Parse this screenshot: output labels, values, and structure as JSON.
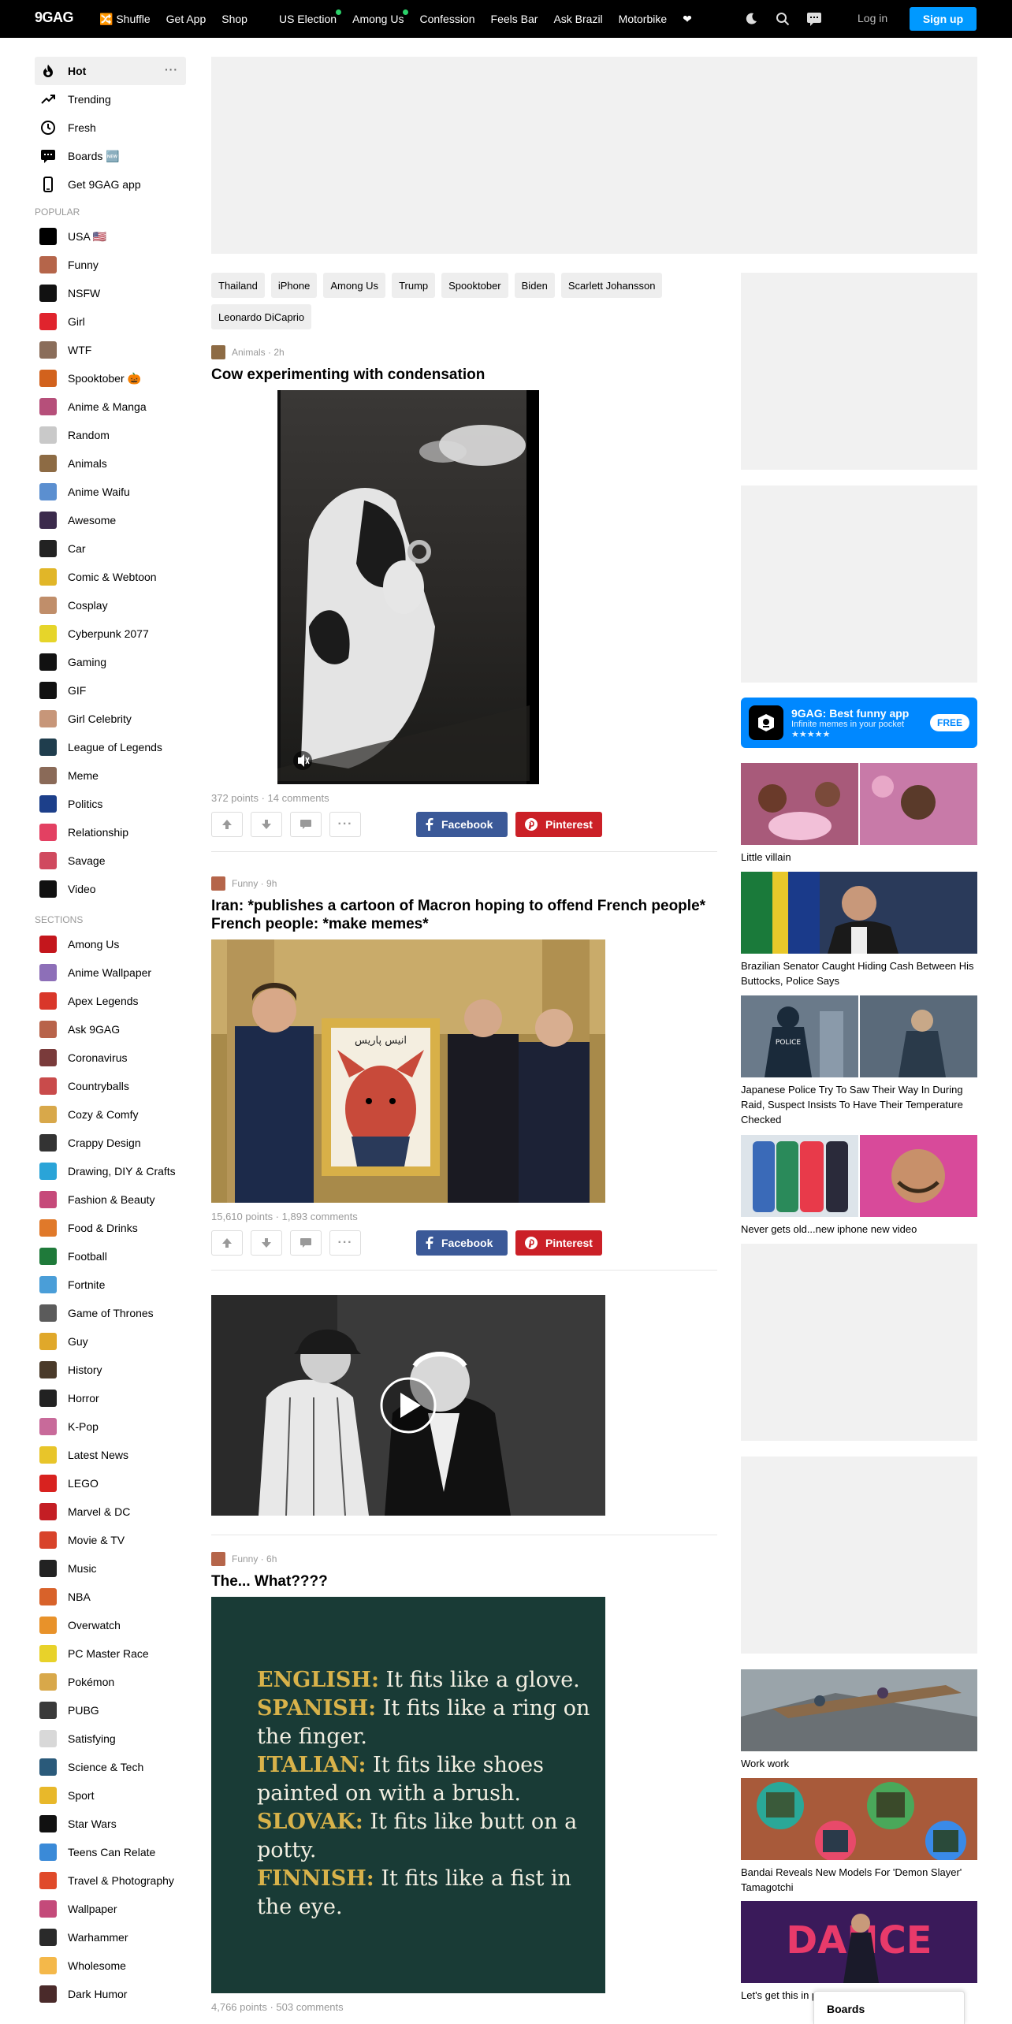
{
  "header": {
    "logo": "9GAG",
    "nav": [
      {
        "label": "🔀 Shuffle",
        "dot": false
      },
      {
        "label": " Get App",
        "dot": false
      },
      {
        "label": " Shop",
        "dot": false
      },
      {
        "label": "",
        "dot": false
      },
      {
        "label": "US Election",
        "dot": true
      },
      {
        "label": "Among Us",
        "dot": true
      },
      {
        "label": "Confession",
        "dot": false
      },
      {
        "label": "Feels Bar",
        "dot": false
      },
      {
        "label": "Ask Brazil",
        "dot": false
      },
      {
        "label": "Motorbike",
        "dot": false
      },
      {
        "label": "❤",
        "dot": false
      }
    ],
    "login": "Log in",
    "signup": "Sign up"
  },
  "sidebar": {
    "main": [
      {
        "label": "Hot",
        "icon": "flame-icon",
        "active": true
      },
      {
        "label": "Trending",
        "icon": "trending-icon"
      },
      {
        "label": "Fresh",
        "icon": "clock-icon"
      },
      {
        "label": "Boards 🆕",
        "icon": "chat-icon"
      },
      {
        "label": "Get 9GAG app",
        "icon": "phone-icon"
      }
    ],
    "popular_label": "POPULAR",
    "popular": [
      {
        "label": "USA 🇺🇸",
        "color": "#000000"
      },
      {
        "label": "Funny",
        "color": "#b5654a"
      },
      {
        "label": "NSFW",
        "color": "#111111"
      },
      {
        "label": "Girl",
        "color": "#e0242d"
      },
      {
        "label": "WTF",
        "color": "#8a6d5a"
      },
      {
        "label": "Spooktober 🎃",
        "color": "#d2621d"
      },
      {
        "label": "Anime & Manga",
        "color": "#b64f7a"
      },
      {
        "label": "Random",
        "color": "#c9c9c9"
      },
      {
        "label": "Animals",
        "color": "#8d6b44"
      },
      {
        "label": "Anime Waifu",
        "color": "#5b8fd0"
      },
      {
        "label": "Awesome",
        "color": "#3b2a4c"
      },
      {
        "label": "Car",
        "color": "#222222"
      },
      {
        "label": "Comic & Webtoon",
        "color": "#e1b628"
      },
      {
        "label": "Cosplay",
        "color": "#c08e6a"
      },
      {
        "label": "Cyberpunk 2077",
        "color": "#e6d52a"
      },
      {
        "label": "Gaming",
        "color": "#111111"
      },
      {
        "label": "GIF",
        "color": "#111111"
      },
      {
        "label": "Girl Celebrity",
        "color": "#c79679"
      },
      {
        "label": "League of Legends",
        "color": "#1f3d4d"
      },
      {
        "label": "Meme",
        "color": "#8a6a58"
      },
      {
        "label": "Politics",
        "color": "#1c3f8a"
      },
      {
        "label": "Relationship",
        "color": "#e34062"
      },
      {
        "label": "Savage",
        "color": "#d04a5f"
      },
      {
        "label": "Video",
        "color": "#111111"
      }
    ],
    "sections_label": "SECTIONS",
    "sections": [
      {
        "label": "Among Us",
        "color": "#c4161c"
      },
      {
        "label": "Anime Wallpaper",
        "color": "#8d6fb8"
      },
      {
        "label": "Apex Legends",
        "color": "#d9372a"
      },
      {
        "label": "Ask 9GAG",
        "color": "#b8634a"
      },
      {
        "label": "Coronavirus",
        "color": "#7a3b3b"
      },
      {
        "label": "Countryballs",
        "color": "#c94b4b"
      },
      {
        "label": "Cozy & Comfy",
        "color": "#d8a84a"
      },
      {
        "label": "Crappy Design",
        "color": "#333333"
      },
      {
        "label": "Drawing, DIY & Crafts",
        "color": "#2aa4d8"
      },
      {
        "label": "Fashion & Beauty",
        "color": "#c64a7a"
      },
      {
        "label": "Food & Drinks",
        "color": "#e0792a"
      },
      {
        "label": "Football",
        "color": "#1f7a3a"
      },
      {
        "label": "Fortnite",
        "color": "#4a9ed8"
      },
      {
        "label": "Game of Thrones",
        "color": "#5b5b5b"
      },
      {
        "label": "Guy",
        "color": "#e0a82a"
      },
      {
        "label": "History",
        "color": "#4a3a2a"
      },
      {
        "label": "Horror",
        "color": "#222222"
      },
      {
        "label": "K-Pop",
        "color": "#c86a9a"
      },
      {
        "label": "Latest News",
        "color": "#e8c52a"
      },
      {
        "label": "LEGO",
        "color": "#d8221f"
      },
      {
        "label": "Marvel & DC",
        "color": "#c41e24"
      },
      {
        "label": "Movie & TV",
        "color": "#d8432a"
      },
      {
        "label": "Music",
        "color": "#222222"
      },
      {
        "label": "NBA",
        "color": "#d8622a"
      },
      {
        "label": "Overwatch",
        "color": "#e8922a"
      },
      {
        "label": "PC Master Race",
        "color": "#e8d22a"
      },
      {
        "label": "Pokémon",
        "color": "#d8a84a"
      },
      {
        "label": "PUBG",
        "color": "#3a3a3a"
      },
      {
        "label": "Satisfying",
        "color": "#d8d8d8"
      },
      {
        "label": "Science & Tech",
        "color": "#2a5a7a"
      },
      {
        "label": "Sport",
        "color": "#e8b82a"
      },
      {
        "label": "Star Wars",
        "color": "#111111"
      },
      {
        "label": "Teens Can Relate",
        "color": "#3a8ad8"
      },
      {
        "label": "Travel & Photography",
        "color": "#e04a2a"
      },
      {
        "label": "Wallpaper",
        "color": "#c44a7a"
      },
      {
        "label": "Warhammer",
        "color": "#2a2a2a"
      },
      {
        "label": "Wholesome",
        "color": "#f4b84a"
      },
      {
        "label": "Dark Humor",
        "color": "#4a2a2a"
      }
    ]
  },
  "tags": [
    "Thailand",
    "iPhone",
    "Among Us",
    "Trump",
    "Spooktober",
    "Biden",
    "Scarlett Johansson",
    "Leonardo DiCaprio"
  ],
  "posts": [
    {
      "section": "Animals · 2h",
      "title": "Cow experimenting with condensation",
      "stats": "372 points · 14 comments"
    },
    {
      "section": "Funny · 9h",
      "title": "Iran: *publishes a cartoon of Macron hoping to offend French people* French people: *make memes*",
      "stats": "15,610 points · 1,893 comments",
      "image_text": "انیس پاریس"
    },
    {
      "section": "Funny · 6h",
      "title": "The... What????",
      "stats": "4,766 points · 503 comments"
    }
  ],
  "share": {
    "facebook": "Facebook",
    "pinterest": "Pinterest"
  },
  "idiom_card": [
    {
      "lang": "ENGLISH:",
      "text": " It fits like a glove."
    },
    {
      "lang": "SPANISH:",
      "text": " It fits like a ring on the finger."
    },
    {
      "lang": "ITALIAN:",
      "text": " It fits like shoes painted on with a brush."
    },
    {
      "lang": "SLOVAK:",
      "text": " It fits like butt on a potty."
    },
    {
      "lang": "FINNISH:",
      "text": " It fits like a fist in the eye."
    }
  ],
  "app_promo": {
    "title": "9GAG: Best funny app",
    "subtitle": "Infinite memes in your pocket",
    "stars": "★★★★★",
    "button": "FREE"
  },
  "rail_cards": [
    {
      "caption": "Little villain"
    },
    {
      "caption": "Brazilian Senator Caught Hiding Cash Between His Buttocks, Police Says"
    },
    {
      "caption": "Japanese Police Try To Saw Their Way In During Raid, Suspect Insists To Have Their Temperature Checked"
    },
    {
      "caption": "Never gets old...new iphone new video"
    },
    {
      "caption": "Work work"
    },
    {
      "caption": "Bandai Reveals New Models For 'Demon Slayer' Tamagotchi"
    },
    {
      "caption": "Let's get this in please."
    }
  ],
  "rail_images": {
    "police": "POLICE",
    "dance": "DANCE"
  },
  "boards_popup": "Boards",
  "colors": {
    "accent": "#0099ff",
    "facebook": "#3b5998",
    "pinterest": "#cb2027",
    "promo": "#0088ff"
  }
}
